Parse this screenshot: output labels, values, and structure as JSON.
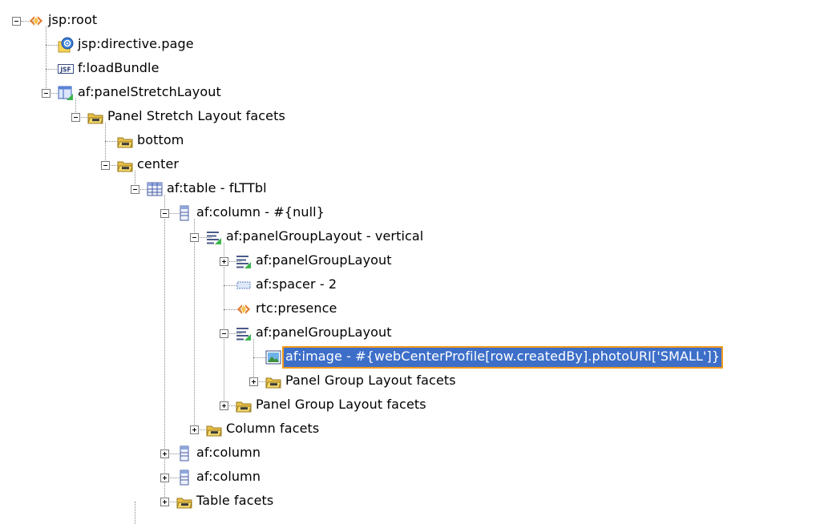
{
  "nodes": [
    {
      "label": "jsp:root",
      "depth": 0,
      "icon": "jsp-root-icon",
      "toggle": "expanded"
    },
    {
      "label": "jsp:directive.page",
      "depth": 1,
      "icon": "directive-page-icon",
      "toggle": "none"
    },
    {
      "label": "f:loadBundle",
      "depth": 1,
      "icon": "jsf-icon",
      "toggle": "none"
    },
    {
      "label": "af:panelStretchLayout",
      "depth": 1,
      "icon": "panel-stretch-layout-icon",
      "toggle": "expanded"
    },
    {
      "label": "Panel Stretch Layout facets",
      "depth": 2,
      "icon": "facets-folder-icon",
      "toggle": "expanded"
    },
    {
      "label": "bottom",
      "depth": 3,
      "icon": "facet-folder-icon",
      "toggle": "none"
    },
    {
      "label": "center",
      "depth": 3,
      "icon": "facet-folder-icon",
      "toggle": "expanded"
    },
    {
      "label": "af:table - fLTTbl",
      "depth": 4,
      "icon": "table-icon",
      "toggle": "expanded"
    },
    {
      "label": "af:column - #{null}",
      "depth": 5,
      "icon": "column-icon",
      "toggle": "expanded"
    },
    {
      "label": "af:panelGroupLayout - vertical",
      "depth": 6,
      "icon": "panel-group-layout-icon",
      "toggle": "expanded"
    },
    {
      "label": "af:panelGroupLayout",
      "depth": 7,
      "icon": "panel-group-layout-icon",
      "toggle": "collapsed"
    },
    {
      "label": "af:spacer - 2",
      "depth": 7,
      "icon": "spacer-icon",
      "toggle": "none"
    },
    {
      "label": "rtc:presence",
      "depth": 7,
      "icon": "rtc-presence-icon",
      "toggle": "none"
    },
    {
      "label": "af:panelGroupLayout",
      "depth": 7,
      "icon": "panel-group-layout-icon",
      "toggle": "expanded"
    },
    {
      "label": "af:image - #{webCenterProfile[row.createdBy].photoURI['SMALL']}",
      "depth": 8,
      "icon": "image-icon",
      "toggle": "none",
      "selected": true
    },
    {
      "label": "Panel Group Layout facets",
      "depth": 8,
      "icon": "facets-folder-icon",
      "toggle": "collapsed"
    },
    {
      "label": "Panel Group Layout facets",
      "depth": 7,
      "icon": "facets-folder-icon",
      "toggle": "collapsed"
    },
    {
      "label": "Column facets",
      "depth": 6,
      "icon": "facets-folder-icon",
      "toggle": "collapsed"
    },
    {
      "label": "af:column",
      "depth": 5,
      "icon": "column-icon",
      "toggle": "collapsed"
    },
    {
      "label": "af:column",
      "depth": 5,
      "icon": "column-icon",
      "toggle": "collapsed"
    },
    {
      "label": "Table facets",
      "depth": 5,
      "icon": "facets-folder-icon",
      "toggle": "collapsed"
    }
  ],
  "colors": {
    "selection_bg": "#3d6fc9",
    "selection_border": "#f29b1d",
    "folder": "#e8c04a",
    "jsp_orange": "#e07a2e"
  }
}
